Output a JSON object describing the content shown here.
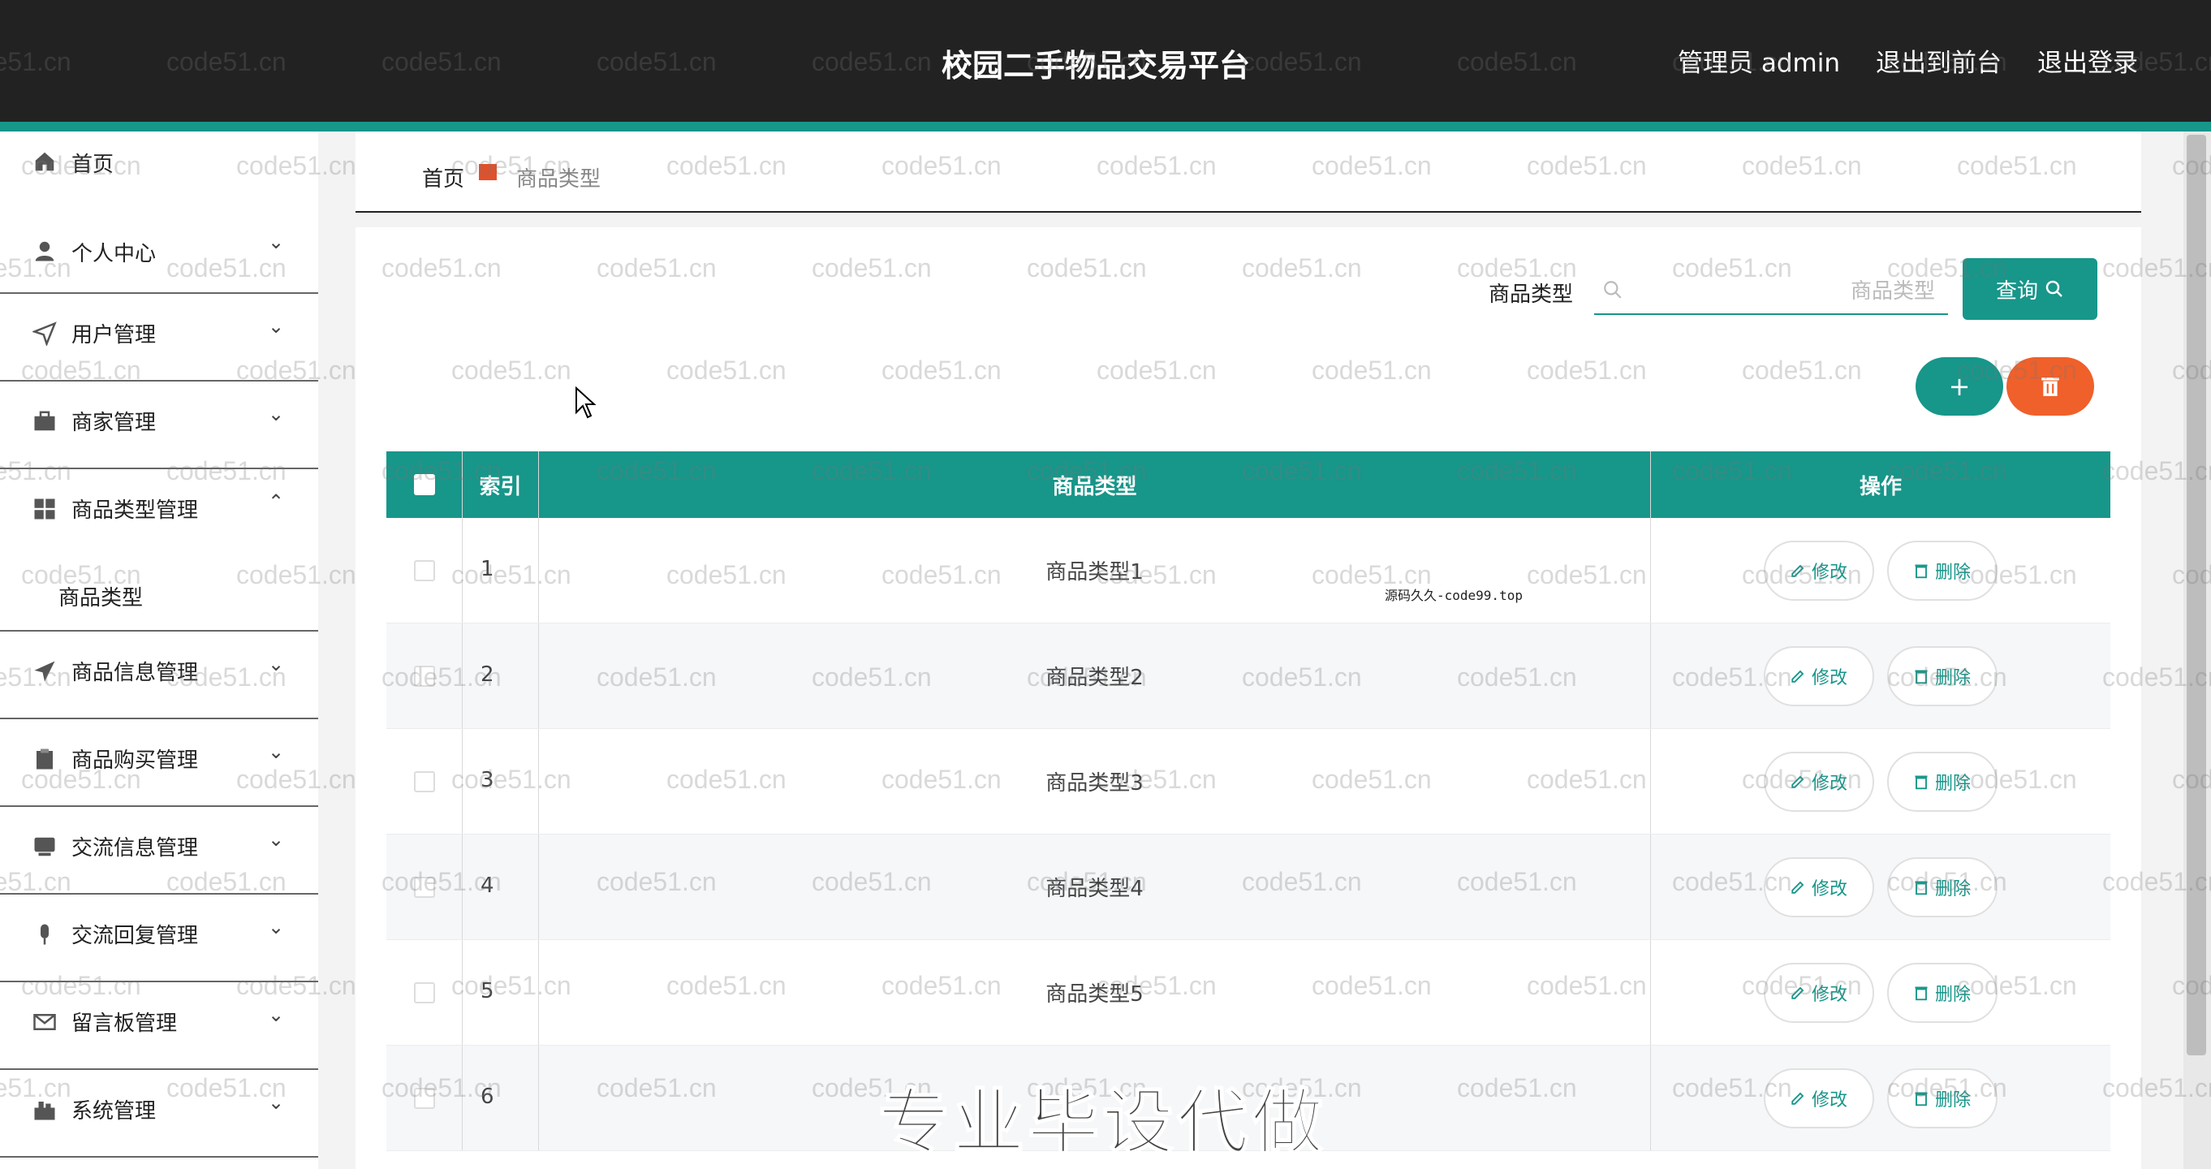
{
  "header": {
    "title": "校园二手物品交易平台",
    "admin_label": "管理员 admin",
    "exit_front": "退出到前台",
    "logout": "退出登录"
  },
  "sidebar": {
    "items": [
      {
        "label": "首页",
        "icon": "home-icon"
      },
      {
        "label": "个人中心",
        "icon": "user-icon"
      },
      {
        "label": "用户管理",
        "icon": "send-icon"
      },
      {
        "label": "商家管理",
        "icon": "briefcase-icon"
      },
      {
        "label": "商品类型管理",
        "icon": "grid-icon"
      },
      {
        "label": "商品信息管理",
        "icon": "plane-icon"
      },
      {
        "label": "商品购买管理",
        "icon": "clipboard-icon"
      },
      {
        "label": "交流信息管理",
        "icon": "chat-icon"
      },
      {
        "label": "交流回复管理",
        "icon": "mic-icon"
      },
      {
        "label": "留言板管理",
        "icon": "mail-icon"
      },
      {
        "label": "系统管理",
        "icon": "settings-icon"
      }
    ],
    "sub_item": "商品类型"
  },
  "breadcrumb": {
    "home": "首页",
    "current": "商品类型"
  },
  "search": {
    "label": "商品类型",
    "placeholder": "商品类型",
    "button": "查询"
  },
  "actions": {
    "add_symbol": "+"
  },
  "table": {
    "headers": {
      "index": "索引",
      "type": "商品类型",
      "op": "操作"
    },
    "edit_label": "修改",
    "delete_label": "删除",
    "note": "源码久久-code99.top",
    "rows": [
      {
        "index": "1",
        "type": "商品类型1"
      },
      {
        "index": "2",
        "type": "商品类型2"
      },
      {
        "index": "3",
        "type": "商品类型3"
      },
      {
        "index": "4",
        "type": "商品类型4"
      },
      {
        "index": "5",
        "type": "商品类型5"
      },
      {
        "index": "6",
        "type": ""
      }
    ]
  },
  "watermark": "code51.cn",
  "overlay_text": "专业毕设代做",
  "colors": {
    "accent": "#17968a",
    "danger": "#f0602a",
    "header_bg": "#222222"
  }
}
